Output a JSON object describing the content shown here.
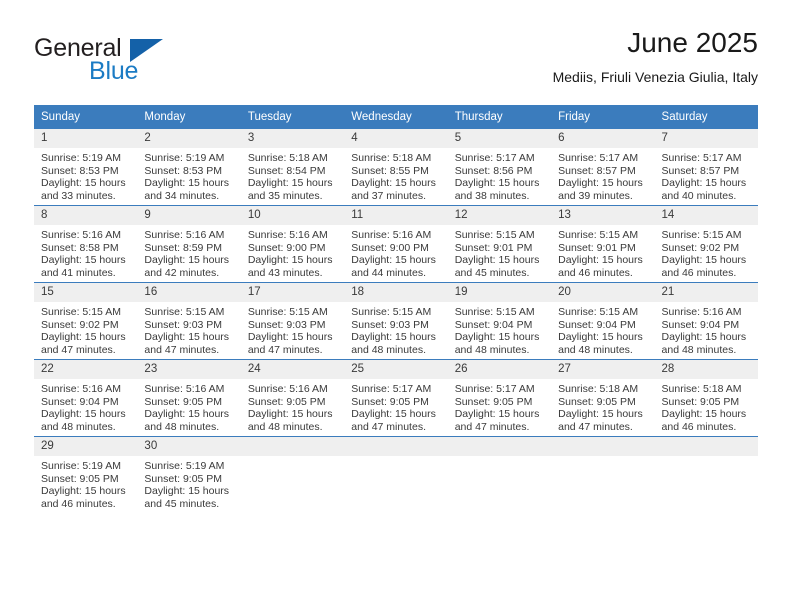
{
  "logo": {
    "word1": "General",
    "word2": "Blue",
    "triangle_color": "#1461a8",
    "word2_color": "#1b7bc4"
  },
  "header": {
    "title": "June 2025",
    "subtitle": "Mediis, Friuli Venezia Giulia, Italy"
  },
  "theme": {
    "header_blue": "#3b7cbd",
    "daynum_bg": "#efefef",
    "text": "#3a3a3a"
  },
  "calendar": {
    "weekday_headers": [
      "Sunday",
      "Monday",
      "Tuesday",
      "Wednesday",
      "Thursday",
      "Friday",
      "Saturday"
    ],
    "weeks": [
      [
        {
          "day": "1",
          "sunrise": "Sunrise: 5:19 AM",
          "sunset": "Sunset: 8:53 PM",
          "daylight1": "Daylight: 15 hours",
          "daylight2": "and 33 minutes."
        },
        {
          "day": "2",
          "sunrise": "Sunrise: 5:19 AM",
          "sunset": "Sunset: 8:53 PM",
          "daylight1": "Daylight: 15 hours",
          "daylight2": "and 34 minutes."
        },
        {
          "day": "3",
          "sunrise": "Sunrise: 5:18 AM",
          "sunset": "Sunset: 8:54 PM",
          "daylight1": "Daylight: 15 hours",
          "daylight2": "and 35 minutes."
        },
        {
          "day": "4",
          "sunrise": "Sunrise: 5:18 AM",
          "sunset": "Sunset: 8:55 PM",
          "daylight1": "Daylight: 15 hours",
          "daylight2": "and 37 minutes."
        },
        {
          "day": "5",
          "sunrise": "Sunrise: 5:17 AM",
          "sunset": "Sunset: 8:56 PM",
          "daylight1": "Daylight: 15 hours",
          "daylight2": "and 38 minutes."
        },
        {
          "day": "6",
          "sunrise": "Sunrise: 5:17 AM",
          "sunset": "Sunset: 8:57 PM",
          "daylight1": "Daylight: 15 hours",
          "daylight2": "and 39 minutes."
        },
        {
          "day": "7",
          "sunrise": "Sunrise: 5:17 AM",
          "sunset": "Sunset: 8:57 PM",
          "daylight1": "Daylight: 15 hours",
          "daylight2": "and 40 minutes."
        }
      ],
      [
        {
          "day": "8",
          "sunrise": "Sunrise: 5:16 AM",
          "sunset": "Sunset: 8:58 PM",
          "daylight1": "Daylight: 15 hours",
          "daylight2": "and 41 minutes."
        },
        {
          "day": "9",
          "sunrise": "Sunrise: 5:16 AM",
          "sunset": "Sunset: 8:59 PM",
          "daylight1": "Daylight: 15 hours",
          "daylight2": "and 42 minutes."
        },
        {
          "day": "10",
          "sunrise": "Sunrise: 5:16 AM",
          "sunset": "Sunset: 9:00 PM",
          "daylight1": "Daylight: 15 hours",
          "daylight2": "and 43 minutes."
        },
        {
          "day": "11",
          "sunrise": "Sunrise: 5:16 AM",
          "sunset": "Sunset: 9:00 PM",
          "daylight1": "Daylight: 15 hours",
          "daylight2": "and 44 minutes."
        },
        {
          "day": "12",
          "sunrise": "Sunrise: 5:15 AM",
          "sunset": "Sunset: 9:01 PM",
          "daylight1": "Daylight: 15 hours",
          "daylight2": "and 45 minutes."
        },
        {
          "day": "13",
          "sunrise": "Sunrise: 5:15 AM",
          "sunset": "Sunset: 9:01 PM",
          "daylight1": "Daylight: 15 hours",
          "daylight2": "and 46 minutes."
        },
        {
          "day": "14",
          "sunrise": "Sunrise: 5:15 AM",
          "sunset": "Sunset: 9:02 PM",
          "daylight1": "Daylight: 15 hours",
          "daylight2": "and 46 minutes."
        }
      ],
      [
        {
          "day": "15",
          "sunrise": "Sunrise: 5:15 AM",
          "sunset": "Sunset: 9:02 PM",
          "daylight1": "Daylight: 15 hours",
          "daylight2": "and 47 minutes."
        },
        {
          "day": "16",
          "sunrise": "Sunrise: 5:15 AM",
          "sunset": "Sunset: 9:03 PM",
          "daylight1": "Daylight: 15 hours",
          "daylight2": "and 47 minutes."
        },
        {
          "day": "17",
          "sunrise": "Sunrise: 5:15 AM",
          "sunset": "Sunset: 9:03 PM",
          "daylight1": "Daylight: 15 hours",
          "daylight2": "and 47 minutes."
        },
        {
          "day": "18",
          "sunrise": "Sunrise: 5:15 AM",
          "sunset": "Sunset: 9:03 PM",
          "daylight1": "Daylight: 15 hours",
          "daylight2": "and 48 minutes."
        },
        {
          "day": "19",
          "sunrise": "Sunrise: 5:15 AM",
          "sunset": "Sunset: 9:04 PM",
          "daylight1": "Daylight: 15 hours",
          "daylight2": "and 48 minutes."
        },
        {
          "day": "20",
          "sunrise": "Sunrise: 5:15 AM",
          "sunset": "Sunset: 9:04 PM",
          "daylight1": "Daylight: 15 hours",
          "daylight2": "and 48 minutes."
        },
        {
          "day": "21",
          "sunrise": "Sunrise: 5:16 AM",
          "sunset": "Sunset: 9:04 PM",
          "daylight1": "Daylight: 15 hours",
          "daylight2": "and 48 minutes."
        }
      ],
      [
        {
          "day": "22",
          "sunrise": "Sunrise: 5:16 AM",
          "sunset": "Sunset: 9:04 PM",
          "daylight1": "Daylight: 15 hours",
          "daylight2": "and 48 minutes."
        },
        {
          "day": "23",
          "sunrise": "Sunrise: 5:16 AM",
          "sunset": "Sunset: 9:05 PM",
          "daylight1": "Daylight: 15 hours",
          "daylight2": "and 48 minutes."
        },
        {
          "day": "24",
          "sunrise": "Sunrise: 5:16 AM",
          "sunset": "Sunset: 9:05 PM",
          "daylight1": "Daylight: 15 hours",
          "daylight2": "and 48 minutes."
        },
        {
          "day": "25",
          "sunrise": "Sunrise: 5:17 AM",
          "sunset": "Sunset: 9:05 PM",
          "daylight1": "Daylight: 15 hours",
          "daylight2": "and 47 minutes."
        },
        {
          "day": "26",
          "sunrise": "Sunrise: 5:17 AM",
          "sunset": "Sunset: 9:05 PM",
          "daylight1": "Daylight: 15 hours",
          "daylight2": "and 47 minutes."
        },
        {
          "day": "27",
          "sunrise": "Sunrise: 5:18 AM",
          "sunset": "Sunset: 9:05 PM",
          "daylight1": "Daylight: 15 hours",
          "daylight2": "and 47 minutes."
        },
        {
          "day": "28",
          "sunrise": "Sunrise: 5:18 AM",
          "sunset": "Sunset: 9:05 PM",
          "daylight1": "Daylight: 15 hours",
          "daylight2": "and 46 minutes."
        }
      ],
      [
        {
          "day": "29",
          "sunrise": "Sunrise: 5:19 AM",
          "sunset": "Sunset: 9:05 PM",
          "daylight1": "Daylight: 15 hours",
          "daylight2": "and 46 minutes."
        },
        {
          "day": "30",
          "sunrise": "Sunrise: 5:19 AM",
          "sunset": "Sunset: 9:05 PM",
          "daylight1": "Daylight: 15 hours",
          "daylight2": "and 45 minutes."
        },
        {
          "day": "",
          "sunrise": "",
          "sunset": "",
          "daylight1": "",
          "daylight2": ""
        },
        {
          "day": "",
          "sunrise": "",
          "sunset": "",
          "daylight1": "",
          "daylight2": ""
        },
        {
          "day": "",
          "sunrise": "",
          "sunset": "",
          "daylight1": "",
          "daylight2": ""
        },
        {
          "day": "",
          "sunrise": "",
          "sunset": "",
          "daylight1": "",
          "daylight2": ""
        },
        {
          "day": "",
          "sunrise": "",
          "sunset": "",
          "daylight1": "",
          "daylight2": ""
        }
      ]
    ]
  }
}
